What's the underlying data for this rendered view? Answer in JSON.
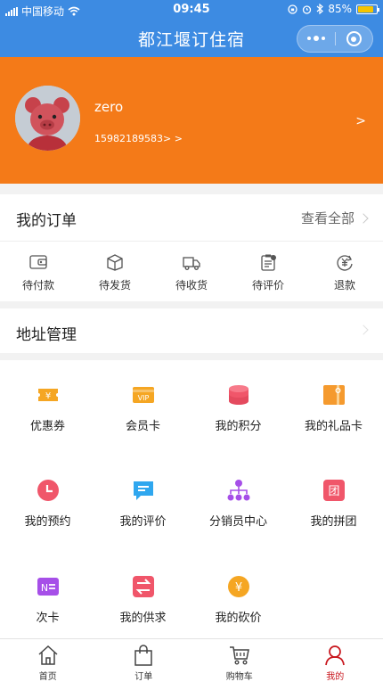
{
  "status_bar": {
    "carrier": "中国移动",
    "time": "09:45",
    "battery": "85%",
    "battery_level": 0.85
  },
  "nav": {
    "title": "都江堰订住宿"
  },
  "profile": {
    "username": "zero",
    "phone": "15982189583> >",
    "arrow": ">"
  },
  "orders": {
    "title": "我的订单",
    "view_all": "查看全部",
    "items": [
      {
        "label": "待付款",
        "icon": "wallet-icon"
      },
      {
        "label": "待发货",
        "icon": "package-icon"
      },
      {
        "label": "待收货",
        "icon": "truck-icon"
      },
      {
        "label": "待评价",
        "icon": "clipboard-icon"
      },
      {
        "label": "退款",
        "icon": "refund-icon"
      }
    ]
  },
  "address": {
    "title": "地址管理"
  },
  "services": [
    {
      "label": "优惠券",
      "icon": "coupon-icon",
      "color": "#f5a623"
    },
    {
      "label": "会员卡",
      "icon": "vip-card-icon",
      "color": "#f5a623"
    },
    {
      "label": "我的积分",
      "icon": "points-icon",
      "color": "#f0566a"
    },
    {
      "label": "我的礼品卡",
      "icon": "gift-card-icon",
      "color": "#f59a2e"
    },
    {
      "label": "我的预约",
      "icon": "clock-icon",
      "color": "#f0566a"
    },
    {
      "label": "我的评价",
      "icon": "comment-icon",
      "color": "#2fa7ef"
    },
    {
      "label": "分销员中心",
      "icon": "network-icon",
      "color": "#a64fe8"
    },
    {
      "label": "我的拼团",
      "icon": "group-icon",
      "color": "#f0566a"
    },
    {
      "label": "次卡",
      "icon": "times-card-icon",
      "color": "#a64fe8"
    },
    {
      "label": "我的供求",
      "icon": "exchange-icon",
      "color": "#f0566a"
    },
    {
      "label": "我的砍价",
      "icon": "bargain-icon",
      "color": "#f5a623"
    }
  ],
  "tabbar": [
    {
      "label": "首页",
      "icon": "home-icon",
      "active": false
    },
    {
      "label": "订单",
      "icon": "bag-icon",
      "active": false
    },
    {
      "label": "购物车",
      "icon": "cart-icon",
      "active": false
    },
    {
      "label": "我的",
      "icon": "user-icon",
      "active": true
    }
  ],
  "colors": {
    "nav": "#3d8be2",
    "profile": "#f47a18",
    "active_tab": "#c8161d"
  }
}
